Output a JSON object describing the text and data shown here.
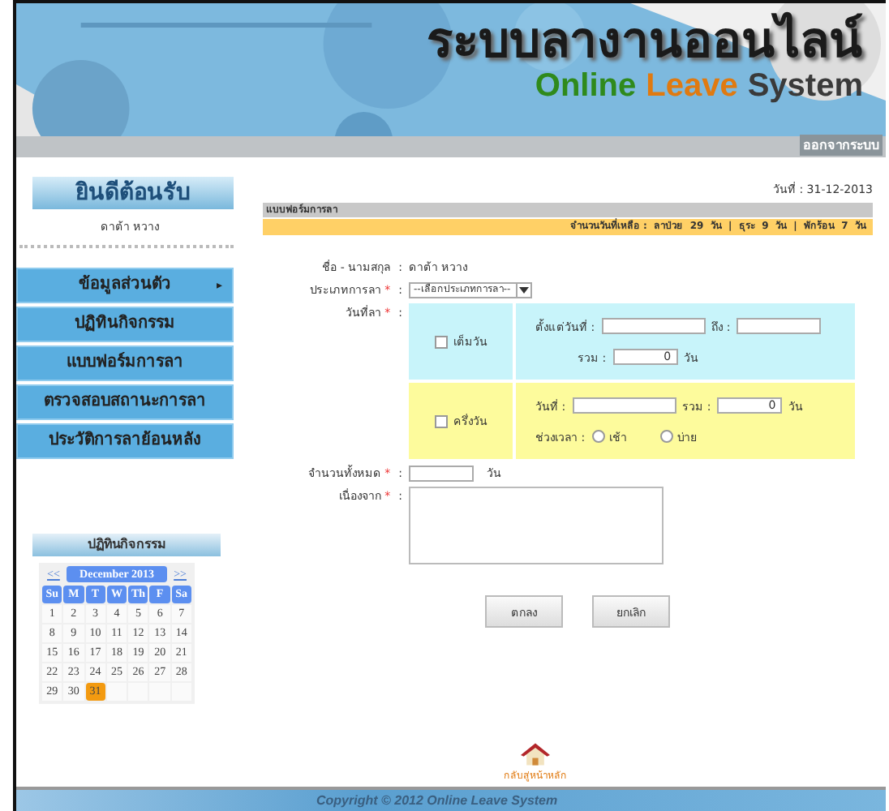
{
  "header": {
    "title_th": "ระบบลางานออนไลน์",
    "title_en": [
      {
        "text": "Online",
        "color": "#2f8a1c"
      },
      {
        "text": "Leave",
        "color": "#e07a10"
      },
      {
        "text": "System",
        "color": "#3a3a3a"
      }
    ],
    "logout": "ออกจากระบบ"
  },
  "sidebar": {
    "welcome": "ยินดีต้อนรับ",
    "user": "ดาต้า หวาง",
    "menu": [
      {
        "label": "ข้อมูลส่วนตัว",
        "arrow": "▸"
      },
      {
        "label": "ปฏิทินกิจกรรม"
      },
      {
        "label": "แบบฟอร์มการลา"
      },
      {
        "label": "ตรวจสอบสถานะการลา"
      },
      {
        "label": "ประวัติการลาย้อนหลัง"
      }
    ],
    "calendar": {
      "title": "ปฏิทินกิจกรรม",
      "prev": "<<",
      "month": "December 2013",
      "next": ">>",
      "weekdays": [
        "Su",
        "M",
        "T",
        "W",
        "Th",
        "F",
        "Sa"
      ],
      "days": [
        {
          "d": "1",
          "selected": false
        },
        {
          "d": "2",
          "selected": false
        },
        {
          "d": "3",
          "selected": false
        },
        {
          "d": "4",
          "selected": false
        },
        {
          "d": "5",
          "selected": false
        },
        {
          "d": "6",
          "selected": false
        },
        {
          "d": "7",
          "selected": false
        },
        {
          "d": "8",
          "selected": false
        },
        {
          "d": "9",
          "selected": false
        },
        {
          "d": "10",
          "selected": false
        },
        {
          "d": "11",
          "selected": false
        },
        {
          "d": "12",
          "selected": false
        },
        {
          "d": "13",
          "selected": false
        },
        {
          "d": "14",
          "selected": false
        },
        {
          "d": "15",
          "selected": false
        },
        {
          "d": "16",
          "selected": false
        },
        {
          "d": "17",
          "selected": false
        },
        {
          "d": "18",
          "selected": false
        },
        {
          "d": "19",
          "selected": false
        },
        {
          "d": "20",
          "selected": false
        },
        {
          "d": "21",
          "selected": false
        },
        {
          "d": "22",
          "selected": false
        },
        {
          "d": "23",
          "selected": false
        },
        {
          "d": "24",
          "selected": false
        },
        {
          "d": "25",
          "selected": false
        },
        {
          "d": "26",
          "selected": false
        },
        {
          "d": "27",
          "selected": false
        },
        {
          "d": "28",
          "selected": false
        },
        {
          "d": "29",
          "selected": false
        },
        {
          "d": "30",
          "selected": false
        },
        {
          "d": "31",
          "selected": true
        }
      ]
    }
  },
  "main": {
    "date": "วันที่ : 31-12-2013",
    "section_title": "แบบฟอร์มการลา",
    "remaining": "จำนวนวันที่เหลือ :  ลาป่วย  29  วัน  |  ธุระ  9  วัน  |  พักร้อน  7  วัน",
    "required_mark": "*",
    "colon": ":",
    "name_label": {
      "text": "ชื่อ - นามสกุล"
    },
    "name_value": "ดาต้า หวาง",
    "type_label": {
      "text": "ประเภทการลา",
      "required": true
    },
    "type_select": "--เลือกประเภทการลา--",
    "date_label": {
      "text": "วันที่ลา",
      "required": true
    },
    "full_day": {
      "label": "เต็มวัน",
      "checked": false,
      "from_label": "ตั้งแต่วันที่ :",
      "to_label": "ถึง :",
      "total_label": "รวม :",
      "total_value": "0",
      "unit": "วัน"
    },
    "half_day": {
      "label": "ครึ่งวัน",
      "checked": false,
      "date_label": "วันที่ :",
      "total_label": "รวม :",
      "total_value": "0",
      "unit": "วัน",
      "period_label": "ช่วงเวลา :",
      "periods": [
        {
          "label": "เช้า",
          "selected": false
        },
        {
          "label": "บ่าย",
          "selected": false
        }
      ]
    },
    "total_label": {
      "text": "จำนวนทั้งหมด",
      "required": true
    },
    "total_unit": "วัน",
    "reason_label": {
      "text": "เนื่องจาก",
      "required": true
    },
    "buttons": [
      "ตกลง",
      "ยกเลิก"
    ],
    "home_link": "กลับสู่หน้าหลัก"
  },
  "footer": "Copyright © 2012 Online Leave System"
}
